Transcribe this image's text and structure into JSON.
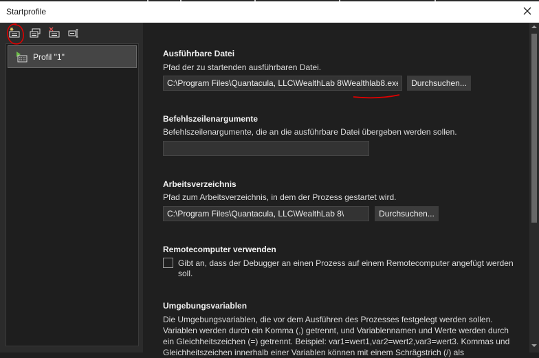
{
  "window": {
    "title": "Startprofile",
    "close_icon": "close-icon"
  },
  "toolbar": {
    "buttons": [
      {
        "icon": "new-profile-icon"
      },
      {
        "icon": "duplicate-profile-icon"
      },
      {
        "icon": "delete-profile-icon"
      },
      {
        "icon": "rename-profile-icon"
      }
    ]
  },
  "profiles": [
    {
      "label": "Profil \"1\"",
      "icon": "launch-profile-icon",
      "selected": true
    }
  ],
  "sections": {
    "executable": {
      "title": "Ausführbare Datei",
      "description": "Pfad der zu startenden ausführbaren Datei.",
      "value": "C:\\Program Files\\Quantacula, LLC\\WealthLab 8\\Wealthlab8.exe",
      "browse_label": "Durchsuchen..."
    },
    "arguments": {
      "title": "Befehlszeilenargumente",
      "description": "Befehlszeilenargumente, die an die ausführbare Datei übergeben werden sollen.",
      "value": ""
    },
    "working_dir": {
      "title": "Arbeitsverzeichnis",
      "description": "Pfad zum Arbeitsverzeichnis, in dem der Prozess gestartet wird.",
      "value": "C:\\Program Files\\Quantacula, LLC\\WealthLab 8\\",
      "browse_label": "Durchsuchen..."
    },
    "remote": {
      "title": "Remotecomputer verwenden",
      "checkbox_label": "Gibt an, dass der Debugger an einen Prozess auf einem Remotecomputer angefügt werden soll.",
      "checked": false
    },
    "env": {
      "title": "Umgebungsvariablen",
      "description": "Die Umgebungsvariablen, die vor dem Ausführen des Prozesses festgelegt werden sollen. Variablen werden durch ein Komma (,) getrennt, und Variablennamen und Werte werden durch ein Gleichheitszeichen (=) getrennt. Beispiel: var1=wert1,var2=wert2,var3=wert3. Kommas und Gleichheitszeichen innerhalb einer Variablen können mit einem Schrägstrich (/) als"
    }
  },
  "colors": {
    "annotation": "#e00000",
    "background": "#1f1f1f",
    "panel": "#2b2b2b"
  }
}
